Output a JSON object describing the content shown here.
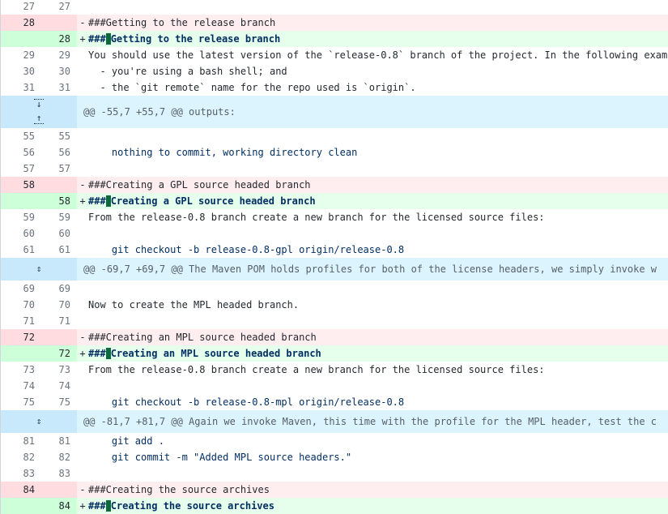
{
  "diff": {
    "rows": [
      {
        "type": "ctx",
        "old": "27",
        "new": "27",
        "text": ""
      },
      {
        "type": "del",
        "old": "28",
        "new": "",
        "marker": "-",
        "text": "###Getting to the release branch"
      },
      {
        "type": "add",
        "old": "",
        "new": "28",
        "marker": "+",
        "prefix": "###",
        "heading": "Getting to the release branch"
      },
      {
        "type": "ctx",
        "old": "29",
        "new": "29",
        "text": "You should use the latest version of the `release-0.8` branch of the project. In the following exam"
      },
      {
        "type": "ctx",
        "old": "30",
        "new": "30",
        "text": "  - you're using a bash shell; and"
      },
      {
        "type": "ctx",
        "old": "31",
        "new": "31",
        "text": "  - the `git remote` name for the repo used is `origin`."
      },
      {
        "type": "hunk",
        "text": "@@ -55,7 +55,7 @@ outputs:"
      },
      {
        "type": "ctx",
        "old": "55",
        "new": "55",
        "text": ""
      },
      {
        "type": "ctx",
        "old": "56",
        "new": "56",
        "text": "    nothing to commit, working directory clean",
        "blue": true
      },
      {
        "type": "ctx",
        "old": "57",
        "new": "57",
        "text": ""
      },
      {
        "type": "del",
        "old": "58",
        "new": "",
        "marker": "-",
        "text": "###Creating a GPL source headed branch"
      },
      {
        "type": "add",
        "old": "",
        "new": "58",
        "marker": "+",
        "prefix": "###",
        "heading": "Creating a GPL source headed branch"
      },
      {
        "type": "ctx",
        "old": "59",
        "new": "59",
        "text": "From the release-0.8 branch create a new branch for the licensed source files:"
      },
      {
        "type": "ctx",
        "old": "60",
        "new": "60",
        "text": ""
      },
      {
        "type": "ctx",
        "old": "61",
        "new": "61",
        "text": "    git checkout -b release-0.8-gpl origin/release-0.8",
        "blue": true
      },
      {
        "type": "hunk-sm",
        "text": "@@ -69,7 +69,7 @@ The Maven POM holds profiles for both of the license headers, we simply invoke w"
      },
      {
        "type": "ctx",
        "old": "69",
        "new": "69",
        "text": ""
      },
      {
        "type": "ctx",
        "old": "70",
        "new": "70",
        "text": "Now to create the MPL headed branch."
      },
      {
        "type": "ctx",
        "old": "71",
        "new": "71",
        "text": ""
      },
      {
        "type": "del",
        "old": "72",
        "new": "",
        "marker": "-",
        "text": "###Creating an MPL source headed branch"
      },
      {
        "type": "add",
        "old": "",
        "new": "72",
        "marker": "+",
        "prefix": "###",
        "heading": "Creating an MPL source headed branch"
      },
      {
        "type": "ctx",
        "old": "73",
        "new": "73",
        "text": "From the release-0.8 branch create a new branch for the licensed source files:"
      },
      {
        "type": "ctx",
        "old": "74",
        "new": "74",
        "text": ""
      },
      {
        "type": "ctx",
        "old": "75",
        "new": "75",
        "text": "    git checkout -b release-0.8-mpl origin/release-0.8",
        "blue": true
      },
      {
        "type": "hunk-sm",
        "text": "@@ -81,7 +81,7 @@ Again we invoke Maven, this time with the profile for the MPL header, test the c"
      },
      {
        "type": "ctx",
        "old": "81",
        "new": "81",
        "text": "    git add .",
        "blue": true
      },
      {
        "type": "ctx",
        "old": "82",
        "new": "82",
        "text": "    git commit -m \"Added MPL source headers.\"",
        "blue": true
      },
      {
        "type": "ctx",
        "old": "83",
        "new": "83",
        "text": ""
      },
      {
        "type": "del",
        "old": "84",
        "new": "",
        "marker": "-",
        "text": "###Creating the source archives"
      },
      {
        "type": "add",
        "old": "",
        "new": "84",
        "marker": "+",
        "prefix": "###",
        "heading": "Creating the source archives"
      }
    ]
  }
}
